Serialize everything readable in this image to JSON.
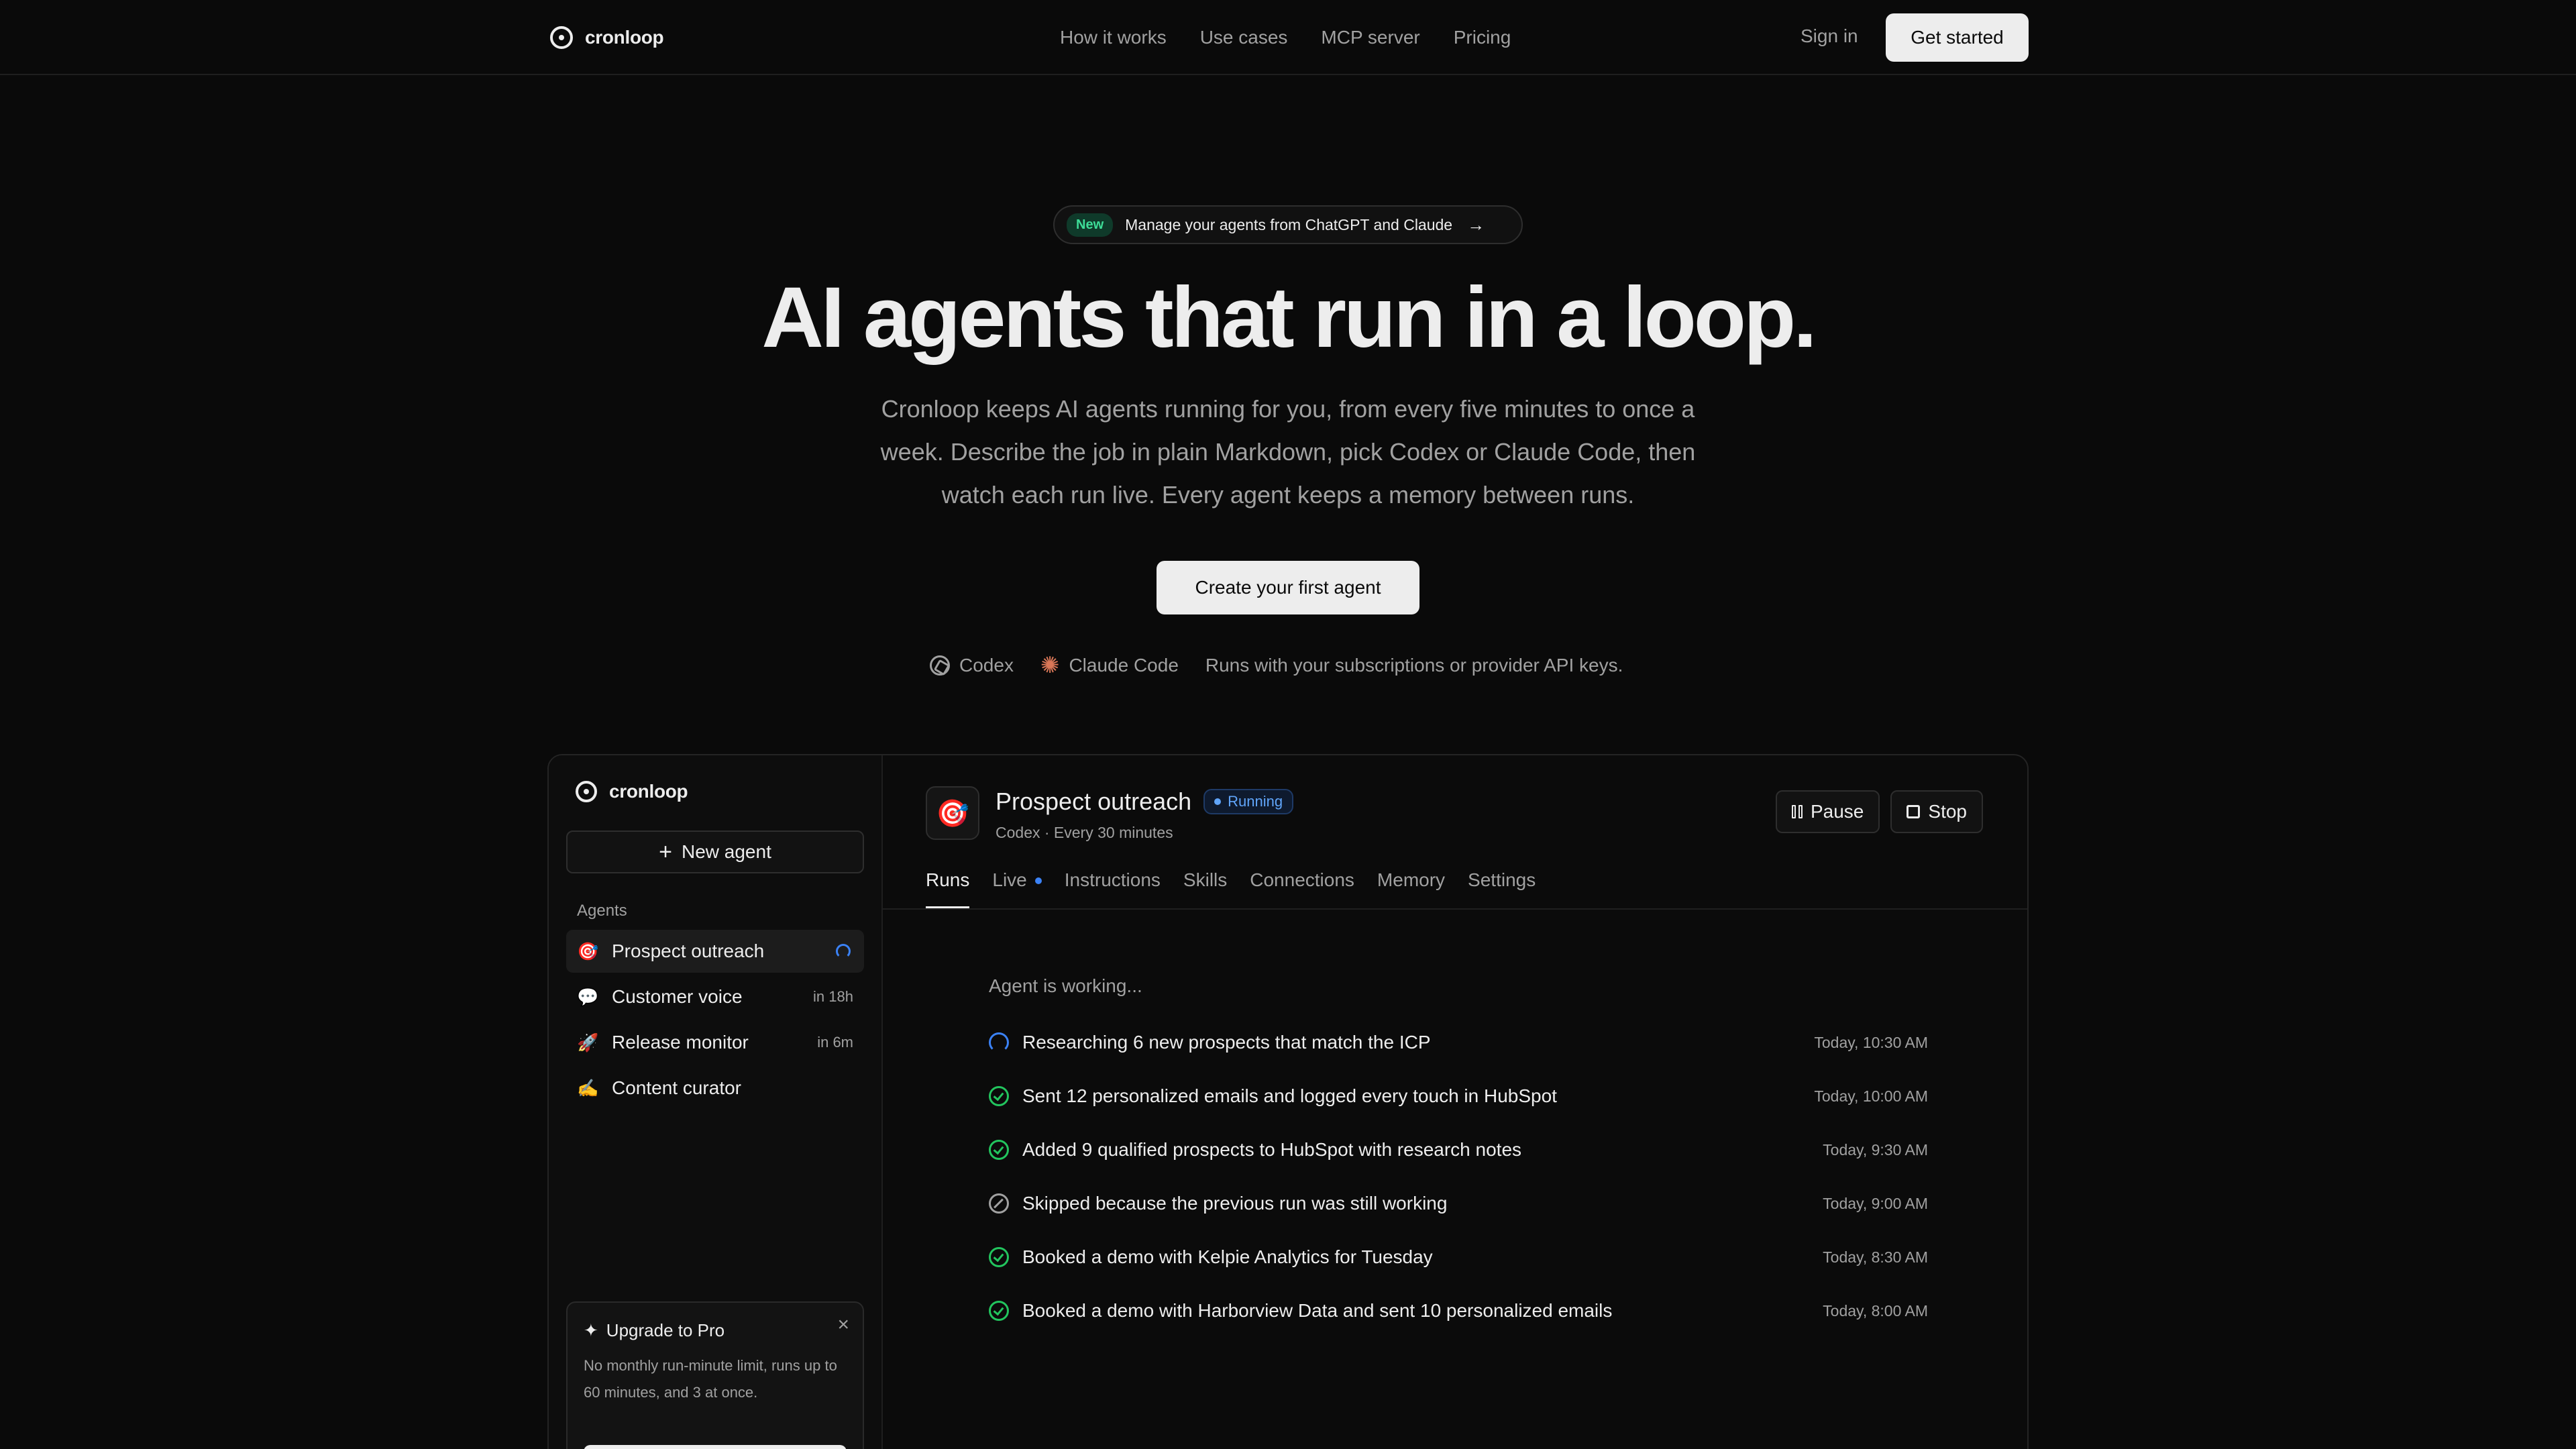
{
  "nav": {
    "brand": "cronloop",
    "links": [
      "How it works",
      "Use cases",
      "MCP server",
      "Pricing"
    ],
    "signin": "Sign in",
    "get_started": "Get started"
  },
  "hero": {
    "badge": "New",
    "announcement": "Manage your agents from ChatGPT and Claude",
    "title": "AI agents that run in a loop.",
    "subtitle": "Cronloop keeps AI agents running for you, from every five minutes to once a week. Describe the job in plain Markdown, pick Codex or Claude Code, then watch each run live. Every agent keeps a memory between runs.",
    "cta": "Create your first agent",
    "providers": {
      "codex": "Codex",
      "claude": "Claude Code",
      "note": "Runs with your subscriptions or provider API keys."
    }
  },
  "app": {
    "brand": "cronloop",
    "new_agent": "New agent",
    "section_label": "Agents",
    "agents": [
      {
        "emoji": "🎯",
        "name": "Prospect outreach",
        "meta": "",
        "active": true,
        "running": true
      },
      {
        "emoji": "💬",
        "name": "Customer voice",
        "meta": "in 18h"
      },
      {
        "emoji": "🚀",
        "name": "Release monitor",
        "meta": "in 6m"
      },
      {
        "emoji": "✍️",
        "name": "Content curator",
        "meta": ""
      }
    ],
    "upgrade": {
      "title": "Upgrade to Pro",
      "body": "No monthly run-minute limit, runs up to 60 minutes, and 3 at once."
    },
    "agent": {
      "emoji": "🎯",
      "title": "Prospect outreach",
      "status": "Running",
      "subtitle": "Codex · Every 30 minutes",
      "pause": "Pause",
      "stop": "Stop"
    },
    "tabs": [
      "Runs",
      "Live",
      "Instructions",
      "Skills",
      "Connections",
      "Memory",
      "Settings"
    ],
    "working_label": "Agent is working...",
    "runs": [
      {
        "status": "running",
        "text": "Researching 6 new prospects that match the ICP",
        "time": "Today, 10:30 AM"
      },
      {
        "status": "success",
        "text": "Sent 12 personalized emails and logged every touch in HubSpot",
        "time": "Today, 10:00 AM"
      },
      {
        "status": "success",
        "text": "Added 9 qualified prospects to HubSpot with research notes",
        "time": "Today, 9:30 AM"
      },
      {
        "status": "skipped",
        "text": "Skipped because the previous run was still working",
        "time": "Today, 9:00 AM"
      },
      {
        "status": "success",
        "text": "Booked a demo with Kelpie Analytics for Tuesday",
        "time": "Today, 8:30 AM"
      },
      {
        "status": "success",
        "text": "Booked a demo with Harborview Data and sent 10 personalized emails",
        "time": "Today, 8:00 AM"
      }
    ]
  }
}
